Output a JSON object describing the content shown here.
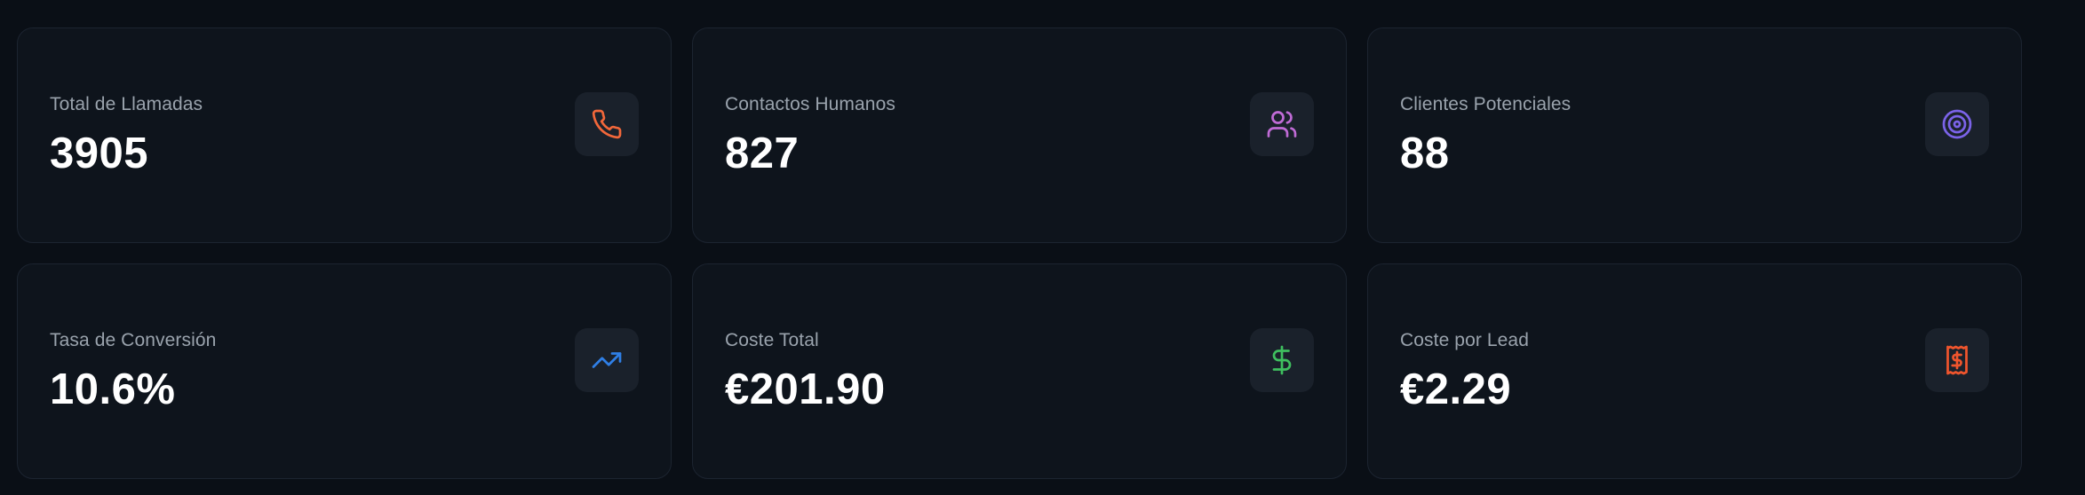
{
  "stats": [
    {
      "label": "Total de Llamadas",
      "value": "3905",
      "icon": "phone-icon",
      "color": "#f2673a"
    },
    {
      "label": "Contactos Humanos",
      "value": "827",
      "icon": "users-icon",
      "color": "#c06bd6"
    },
    {
      "label": "Clientes Potenciales",
      "value": "88",
      "icon": "target-icon",
      "color": "#7b63e8"
    },
    {
      "label": "Tasa de Conversión",
      "value": "10.6%",
      "icon": "trending-up-icon",
      "color": "#2f7fe6"
    },
    {
      "label": "Coste Total",
      "value": "€201.90",
      "icon": "dollar-sign-icon",
      "color": "#3fbf5f"
    },
    {
      "label": "Coste por Lead",
      "value": "€2.29",
      "icon": "receipt-icon",
      "color": "#f0552d"
    }
  ]
}
